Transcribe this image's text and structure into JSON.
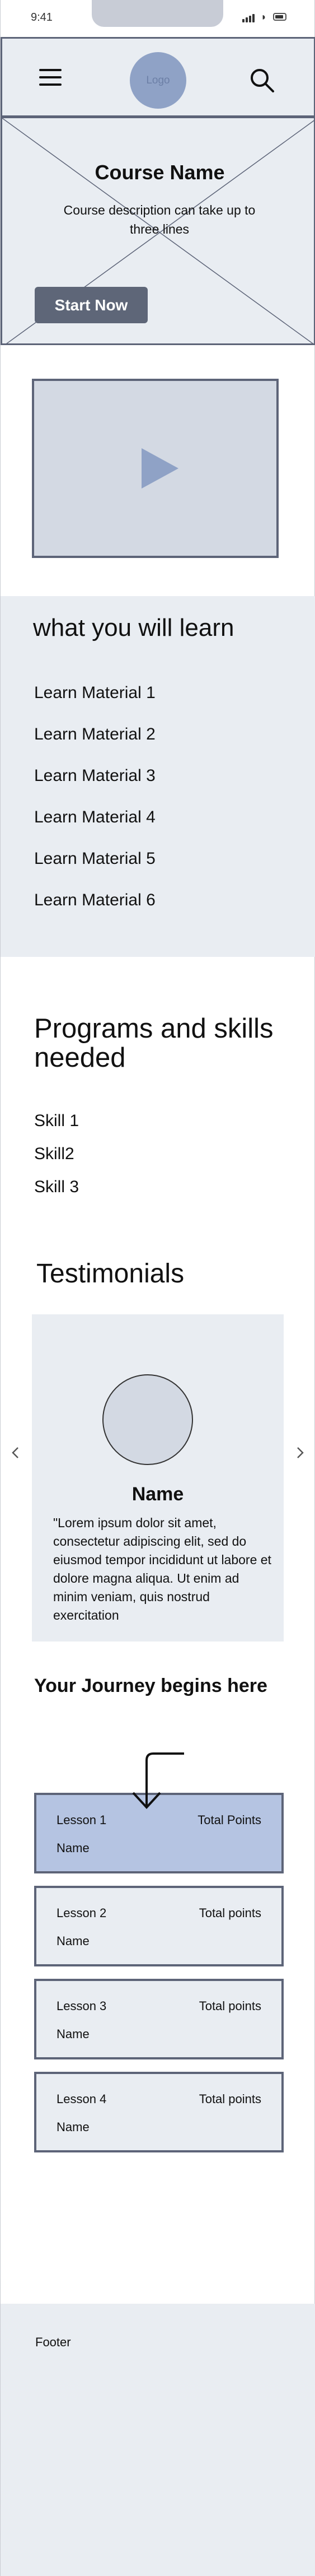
{
  "status_bar": {
    "time": "9:41"
  },
  "header": {
    "logo_text": "Logo",
    "menu_icon": "hamburger-menu-icon",
    "search_icon": "search-icon"
  },
  "hero": {
    "title": "Course Name",
    "description": "Course description can take up to three lines",
    "cta_label": "Start Now"
  },
  "video": {
    "icon": "play-icon"
  },
  "learn": {
    "heading": "what you will learn",
    "items": [
      "Learn Material 1",
      "Learn Material 2",
      "Learn Material 3",
      "Learn Material 4",
      "Learn Material 5",
      "Learn Material 6"
    ]
  },
  "skills": {
    "heading": "Programs and skills needed",
    "items": [
      "Skill 1",
      "Skill2",
      "Skill 3"
    ]
  },
  "testimonials": {
    "heading": "Testimonials",
    "name": "Name",
    "quote": "\"Lorem ipsum dolor sit amet, consectetur adipiscing elit, sed do eiusmod tempor incididunt ut labore et dolore magna aliqua. Ut enim ad minim veniam, quis nostrud exercitation"
  },
  "journey": {
    "heading": "Your Journey begins here",
    "lessons": [
      {
        "title": "Lesson 1",
        "points": "Total Points",
        "name": "Name"
      },
      {
        "title": "Lesson 2",
        "points": "Total points",
        "name": "Name"
      },
      {
        "title": "Lesson 3",
        "points": "Total points",
        "name": "Name"
      },
      {
        "title": "Lesson 4",
        "points": "Total points",
        "name": "Name"
      }
    ]
  },
  "footer": {
    "label": "Footer"
  },
  "colors": {
    "accent": "#b5c4e2",
    "panel": "#e9edf2",
    "border": "#5d6478",
    "button": "#5e6678"
  }
}
